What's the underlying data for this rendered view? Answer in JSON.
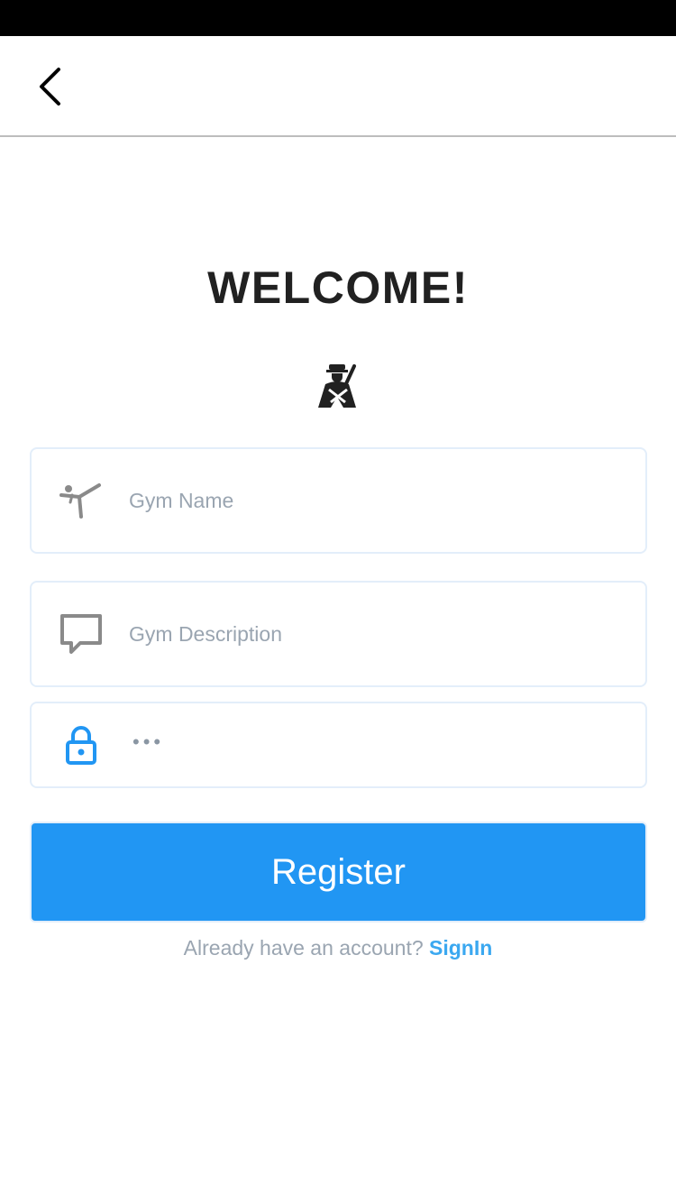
{
  "header": {
    "back_icon": "chevron-left-icon"
  },
  "main": {
    "title": "WELCOME!",
    "brand_icon": "martial-artist-icon"
  },
  "form": {
    "gym_name": {
      "icon": "high-kick-icon",
      "placeholder": "Gym Name",
      "value": ""
    },
    "gym_description": {
      "icon": "message-square-icon",
      "placeholder": "Gym Description",
      "value": ""
    },
    "password": {
      "icon": "lock-icon",
      "masked_value": "•••"
    },
    "register_label": "Register"
  },
  "footer": {
    "prompt": "Already have an account? ",
    "signin_label": "SignIn"
  },
  "colors": {
    "accent": "#2196f3",
    "link": "#3ba8f0",
    "placeholder": "#9aa5b1",
    "field_border": "#e3eefa",
    "lock_icon": "#2196f3",
    "field_icon": "#8a8a8a"
  }
}
